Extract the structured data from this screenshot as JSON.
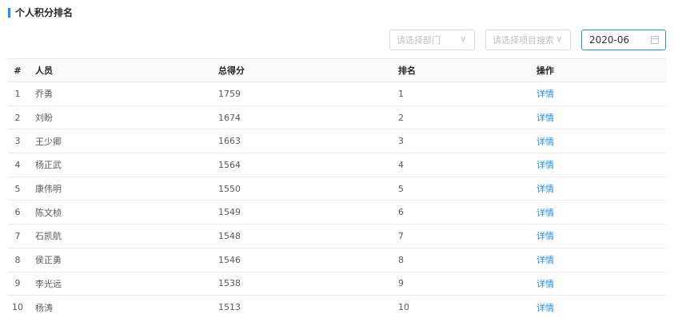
{
  "section": {
    "title": "个人积分排名"
  },
  "filters": {
    "department": {
      "placeholder": "请选择部门",
      "arrow": "∨"
    },
    "project": {
      "placeholder": "请选择项目搜索",
      "arrow": "∨"
    },
    "date": {
      "value": "2020-06"
    }
  },
  "table": {
    "headers": {
      "index": "#",
      "name": "人员",
      "score": "总得分",
      "rank": "排名",
      "op": "操作"
    },
    "rows": [
      {
        "index": "1",
        "name": "乔勇",
        "score": "1759",
        "rank": "1",
        "op": "详情"
      },
      {
        "index": "2",
        "name": "刘盼",
        "score": "1674",
        "rank": "2",
        "op": "详情"
      },
      {
        "index": "3",
        "name": "王少卿",
        "score": "1663",
        "rank": "3",
        "op": "详情"
      },
      {
        "index": "4",
        "name": "杨正武",
        "score": "1564",
        "rank": "4",
        "op": "详情"
      },
      {
        "index": "5",
        "name": "康伟明",
        "score": "1550",
        "rank": "5",
        "op": "详情"
      },
      {
        "index": "6",
        "name": "陈文桢",
        "score": "1549",
        "rank": "6",
        "op": "详情"
      },
      {
        "index": "7",
        "name": "石凯航",
        "score": "1548",
        "rank": "7",
        "op": "详情"
      },
      {
        "index": "8",
        "name": "侯正勇",
        "score": "1546",
        "rank": "8",
        "op": "详情"
      },
      {
        "index": "9",
        "name": "李光远",
        "score": "1538",
        "rank": "9",
        "op": "详情"
      },
      {
        "index": "10",
        "name": "杨涛",
        "score": "1513",
        "rank": "10",
        "op": "详情"
      }
    ]
  },
  "colors": {
    "accent": "#1890ff",
    "border": "#eaeaea",
    "header_bg": "#fafafa"
  }
}
